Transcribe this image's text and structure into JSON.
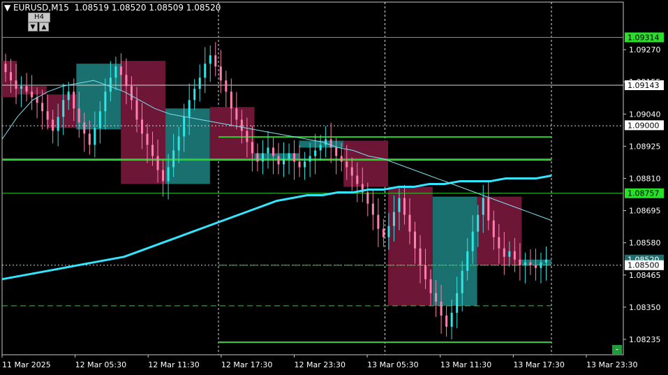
{
  "header": {
    "symbol": "EURUSD,M15",
    "ohlc": "1.08519 1.08520 1.08509 1.08520",
    "timeframe_button": "H4",
    "collapse_icon": "triangle-down-icon",
    "arrow_left_icon": "arrow-down-icon",
    "arrow_right_icon": "arrow-up-icon",
    "minus_button": "-"
  },
  "colors": {
    "background": "#000000",
    "bull": "#2ee6e6",
    "bear": "#ff7fb0",
    "htf_bull": "#19706f",
    "htf_bear": "#6e1636",
    "level": "#2bd02b",
    "ma_slow": "#33e6ff",
    "ma_fast": "#7fe0f0",
    "grid": "#c0c0c0"
  },
  "chart_data": {
    "type": "candlestick",
    "symbol": "EURUSD",
    "timeframe": "M15",
    "ylim": [
      1.0818,
      1.0944
    ],
    "y_ticks": [
      "1.09270",
      "1.09155",
      "1.09040",
      "1.08925",
      "1.08810",
      "1.08695",
      "1.08580",
      "1.08465",
      "1.08350",
      "1.08235"
    ],
    "x_ticks": [
      "11 Mar 2025",
      "12 Mar 05:30",
      "12 Mar 11:30",
      "12 Mar 17:30",
      "12 Mar 23:30",
      "13 Mar 05:30",
      "13 Mar 11:30",
      "13 Mar 17:30",
      "13 Mar 23:30"
    ],
    "price_labels": [
      {
        "text": "1.09314",
        "value": 1.09314,
        "style": "green"
      },
      {
        "text": "1.09143",
        "value": 1.09143,
        "style": "white"
      },
      {
        "text": "1.09000",
        "value": 1.09,
        "style": "white"
      },
      {
        "text": "1.08757",
        "value": 1.08757,
        "style": "green"
      },
      {
        "text": "1.08520",
        "value": 1.0852,
        "style": "current"
      },
      {
        "text": "1.08500",
        "value": 1.085,
        "style": "white"
      }
    ],
    "vertical_dashed_lines": [
      13,
      23,
      33
    ],
    "horizontal_levels": [
      {
        "value": 1.09314,
        "from": 0,
        "to": 36,
        "style": "thin"
      },
      {
        "value": 1.09143,
        "from": 0,
        "to": 36,
        "style": "white"
      },
      {
        "value": 1.08998,
        "from": 0,
        "to": 36,
        "style": "white-dotted"
      },
      {
        "value": 1.08958,
        "from": 13,
        "to": 33,
        "style": "solid"
      },
      {
        "value": 1.08877,
        "from": 0,
        "to": 33,
        "style": "thick"
      },
      {
        "value": 1.08757,
        "from": 0,
        "to": 36,
        "style": "thin"
      },
      {
        "value": 1.085,
        "from": 0,
        "to": 36,
        "style": "white-dotted"
      },
      {
        "value": 1.085,
        "from": 13,
        "to": 33,
        "style": "dash-long"
      },
      {
        "value": 1.08355,
        "from": 0,
        "to": 33,
        "style": "dash"
      },
      {
        "value": 1.08225,
        "from": 13,
        "to": 33,
        "style": "solid"
      }
    ],
    "htf_candles": [
      {
        "i": 0,
        "o": 1.0923,
        "c": 1.091
      },
      {
        "i": 1,
        "o": 1.0914,
        "c": 1.09105
      },
      {
        "i": 2,
        "o": 1.0911,
        "c": 1.0905
      },
      {
        "i": 3,
        "o": 1.0905,
        "c": 1.0899
      },
      {
        "i": 4,
        "o": 1.08985,
        "c": 1.0922
      },
      {
        "i": 5,
        "o": 1.0923,
        "c": 1.08915
      },
      {
        "i": 6,
        "o": 1.0888,
        "c": 1.0879
      },
      {
        "i": 7,
        "o": 1.0879,
        "c": 1.0906
      },
      {
        "i": 8,
        "o": 1.09065,
        "c": 1.08877
      },
      {
        "i": 9,
        "o": 1.08877,
        "c": 1.0893
      },
      {
        "i": 10,
        "o": 1.0893,
        "c": 1.08908
      },
      {
        "i": 11,
        "o": 1.08908,
        "c": 1.0895
      },
      {
        "i": 12,
        "o": 1.0895,
        "c": 1.0878
      },
      {
        "i": 13,
        "o": 1.08778,
        "c": 1.08355
      },
      {
        "i": 14,
        "o": 1.08355,
        "c": 1.08745
      },
      {
        "i": 15,
        "o": 1.08745,
        "c": 1.085
      },
      {
        "i": 16,
        "o": 1.085,
        "c": 1.0852
      }
    ],
    "htf_columns": [
      {
        "x0": 0,
        "x1": 1,
        "o": 1.0923,
        "c": 1.091
      },
      {
        "x0": 1,
        "x1": 3,
        "o": 1.0914,
        "c": 1.0911
      },
      {
        "x0": 3,
        "x1": 5,
        "o": 1.0911,
        "c": 1.0899
      },
      {
        "x0": 5,
        "x1": 8,
        "o": 1.08985,
        "c": 1.0922
      },
      {
        "x0": 8,
        "x1": 11,
        "o": 1.0923,
        "c": 1.0879
      },
      {
        "x0": 11,
        "x1": 14,
        "o": 1.0879,
        "c": 1.0906
      },
      {
        "x0": 14,
        "x1": 17,
        "o": 1.09065,
        "c": 1.08877
      },
      {
        "x0": 17,
        "x1": 20,
        "o": 1.08877,
        "c": 1.089
      },
      {
        "x0": 20,
        "x1": 23,
        "o": 1.0892,
        "c": 1.08945
      },
      {
        "x0": 23,
        "x1": 26,
        "o": 1.08945,
        "c": 1.0878
      },
      {
        "x0": 26,
        "x1": 29,
        "o": 1.0878,
        "c": 1.08355
      },
      {
        "x0": 29,
        "x1": 32,
        "o": 1.08355,
        "c": 1.08745
      },
      {
        "x0": 32,
        "x1": 35,
        "o": 1.08745,
        "c": 1.085
      },
      {
        "x0": 35,
        "x1": 37,
        "o": 1.085,
        "c": 1.0852
      }
    ],
    "candles_close": [
      1.0919,
      1.0916,
      1.0913,
      1.0914,
      1.0912,
      1.091,
      1.0908,
      1.0905,
      1.0902,
      1.0898,
      1.0903,
      1.0909,
      1.0912,
      1.0906,
      1.0901,
      1.0897,
      1.0893,
      1.0899,
      1.0905,
      1.0912,
      1.0917,
      1.0921,
      1.0918,
      1.0914,
      1.0909,
      1.0902,
      1.0897,
      1.0893,
      1.0889,
      1.0884,
      1.088,
      1.0885,
      1.0891,
      1.0896,
      1.0903,
      1.0909,
      1.0913,
      1.0917,
      1.0922,
      1.0925,
      1.0921,
      1.0916,
      1.0912,
      1.0906,
      1.0902,
      1.0898,
      1.0894,
      1.089,
      1.0887,
      1.089,
      1.0892,
      1.0889,
      1.0886,
      1.0888,
      1.089,
      1.0887,
      1.0885,
      1.0887,
      1.0889,
      1.0891,
      1.0893,
      1.0895,
      1.0892,
      1.0889,
      1.0887,
      1.0885,
      1.0882,
      1.0879,
      1.0876,
      1.0872,
      1.0868,
      1.0863,
      1.086,
      1.0864,
      1.0869,
      1.0874,
      1.0868,
      1.0862,
      1.0856,
      1.085,
      1.0845,
      1.084,
      1.0837,
      1.0832,
      1.0828,
      1.0833,
      1.084,
      1.0848,
      1.0855,
      1.0862,
      1.0868,
      1.0874,
      1.0866,
      1.086,
      1.0856,
      1.0853,
      1.0855,
      1.0852,
      1.085,
      1.0851,
      1.085,
      1.0849,
      1.0851,
      1.0852
    ],
    "ma_slow": [
      1.0845,
      1.0846,
      1.0847,
      1.0848,
      1.0849,
      1.085,
      1.0851,
      1.0852,
      1.0853,
      1.0855,
      1.0857,
      1.0859,
      1.0861,
      1.0863,
      1.0865,
      1.0867,
      1.0869,
      1.0871,
      1.0873,
      1.0874,
      1.0875,
      1.0875,
      1.0876,
      1.0876,
      1.0877,
      1.0877,
      1.0878,
      1.0878,
      1.0879,
      1.0879,
      1.088,
      1.088,
      1.088,
      1.0881,
      1.0881,
      1.0881,
      1.0882
    ],
    "ma_fast": [
      1.0895,
      1.0903,
      1.0909,
      1.0912,
      1.0914,
      1.0915,
      1.0916,
      1.0914,
      1.0912,
      1.0909,
      1.0906,
      1.0904,
      1.0903,
      1.0902,
      1.0901,
      1.09,
      1.0899,
      1.0898,
      1.0897,
      1.0896,
      1.0895,
      1.0894,
      1.0892,
      1.0891,
      1.0889,
      1.0888,
      1.0886,
      1.0884,
      1.0882,
      1.088,
      1.0878,
      1.0876,
      1.0874,
      1.0872,
      1.087,
      1.0868,
      1.0866
    ]
  }
}
